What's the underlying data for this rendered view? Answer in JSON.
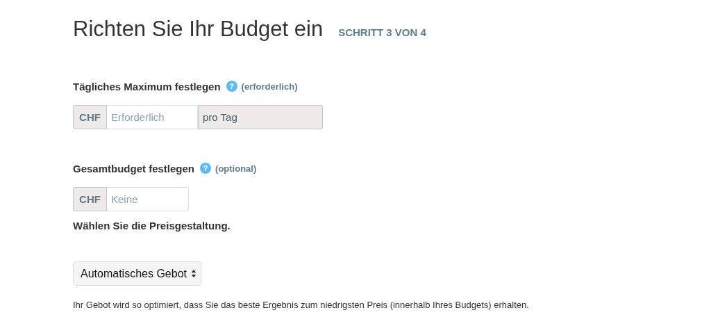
{
  "title": "Richten Sie Ihr Budget ein",
  "step": "SCHRITT 3 VON 4",
  "fields": [
    {
      "kind": "money",
      "label": "Tägliches Maximum festlegen",
      "help": "?",
      "note": "(erforderlich)",
      "prefix": "CHF",
      "placeholder": "Erforderlich",
      "suffix": "pro Tag"
    },
    {
      "kind": "money",
      "label": "Gesamtbudget festlegen",
      "help": "?",
      "note": "(optional)",
      "prefix": "CHF",
      "placeholder": "Keine"
    },
    {
      "kind": "select",
      "label": "Wählen Sie die Preisgestaltung.",
      "value": "Automatisches Gebot",
      "description": "Ihr Gebot wird so optimiert, dass Sie das beste Ergebnis zum niedrigsten Preis (innerhalb Ihres Budgets) erhalten."
    }
  ]
}
